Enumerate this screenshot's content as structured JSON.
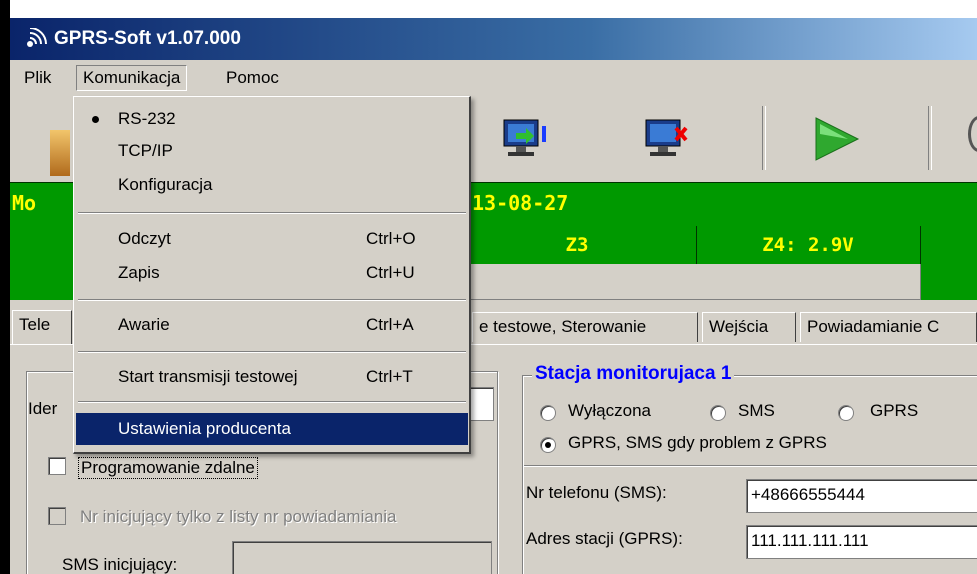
{
  "app": {
    "title": "GPRS-Soft v1.07.000"
  },
  "menubar": {
    "items": [
      "Plik",
      "Komunikacja",
      "Pomoc"
    ]
  },
  "dropdown": {
    "items": [
      {
        "label": "RS-232",
        "shortcut": "",
        "checked": true
      },
      {
        "label": "TCP/IP",
        "shortcut": ""
      },
      {
        "label": "Konfiguracja",
        "shortcut": ""
      },
      {
        "label": "Odczyt",
        "shortcut": "Ctrl+O"
      },
      {
        "label": "Zapis",
        "shortcut": "Ctrl+U"
      },
      {
        "label": "Awarie",
        "shortcut": "Ctrl+A"
      },
      {
        "label": "Start transmisji testowej",
        "shortcut": "Ctrl+T"
      },
      {
        "label": "Ustawienia producenta",
        "shortcut": "",
        "highlighted": true
      }
    ]
  },
  "status": {
    "left_text": "Mo",
    "date_text": "13-08-27"
  },
  "zones": {
    "z3": "Z3",
    "z4": "Z4: 2.9V"
  },
  "tabs": {
    "partial_left": "Tele",
    "partial_test": "e testowe, Sterowanie",
    "inputs": "Wejścia",
    "notify": "Powiadamianie C"
  },
  "left_panel": {
    "ident_label": "Ider",
    "remote_prog": "Programowanie zdalne",
    "remote_prog_checked": false,
    "init_only": "Nr inicjujący tylko z listy nr powiadamiania",
    "sms_label": "SMS inicjujący:"
  },
  "station": {
    "title": "Stacja monitorujaca 1",
    "opt_off": "Wyłączona",
    "opt_sms": "SMS",
    "opt_gprs": "GPRS",
    "opt_gprs_sms": "GPRS, SMS gdy problem z GPRS",
    "selected": "GPRS, SMS gdy problem z GPRS",
    "phone_label": "Nr telefonu (SMS):",
    "phone_value": "+48666555444",
    "addr_label": "Adres stacji (GPRS):",
    "addr_value": "111.111.111.111"
  },
  "colors": {
    "status_bg": "#009900",
    "status_text": "#ffff00",
    "group_title": "#0000ff",
    "highlight": "#0a246a"
  }
}
